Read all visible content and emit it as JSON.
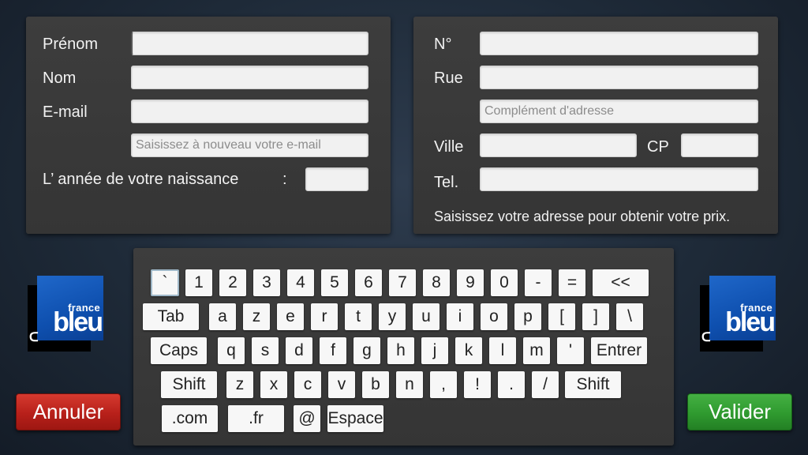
{
  "personal": {
    "labels": {
      "first_name": "Prénom",
      "last_name": "Nom",
      "email": "E-mail",
      "birth_year": "L’ année de votre naissance",
      "birth_colon": ":"
    },
    "values": {
      "first_name": "",
      "last_name": "",
      "email": "",
      "email_confirm": "",
      "birth_year": ""
    },
    "placeholders": {
      "email_confirm": "Saisissez à nouveau votre e-mail"
    }
  },
  "address": {
    "labels": {
      "number": "N°",
      "street": "Rue",
      "city": "Ville",
      "postcode": "CP",
      "phone": "Tel."
    },
    "values": {
      "number": "",
      "street": "",
      "complement": "",
      "city": "",
      "postcode": "",
      "phone": ""
    },
    "placeholders": {
      "complement": "Complément d'adresse"
    },
    "hint": "Saisissez votre adresse pour obtenir votre prix."
  },
  "keyboard": {
    "row1": [
      "`",
      "1",
      "2",
      "3",
      "4",
      "5",
      "6",
      "7",
      "8",
      "9",
      "0",
      "-",
      "=",
      "<<"
    ],
    "row2": [
      "Tab",
      "a",
      "z",
      "e",
      "r",
      "t",
      "y",
      "u",
      "i",
      "o",
      "p",
      "[",
      "]",
      "\\"
    ],
    "row3": [
      "Caps",
      "q",
      "s",
      "d",
      "f",
      "g",
      "h",
      "j",
      "k",
      "l",
      "m",
      "'",
      "Entrer"
    ],
    "row4": [
      "Shift",
      "z",
      "x",
      "c",
      "v",
      "b",
      "n",
      ",",
      "!",
      ".",
      "/",
      "Shift"
    ],
    "row5": [
      ".com",
      ".fr",
      "@",
      "Espace"
    ]
  },
  "buttons": {
    "cancel": "Annuler",
    "validate": "Valider"
  },
  "logo": {
    "line1": "france",
    "line2": "bleu",
    "mark": "ᑕ"
  },
  "colors": {
    "brand_blue": "#1558bd",
    "cancel_red": "#c0241c",
    "validate_green": "#34a034"
  }
}
